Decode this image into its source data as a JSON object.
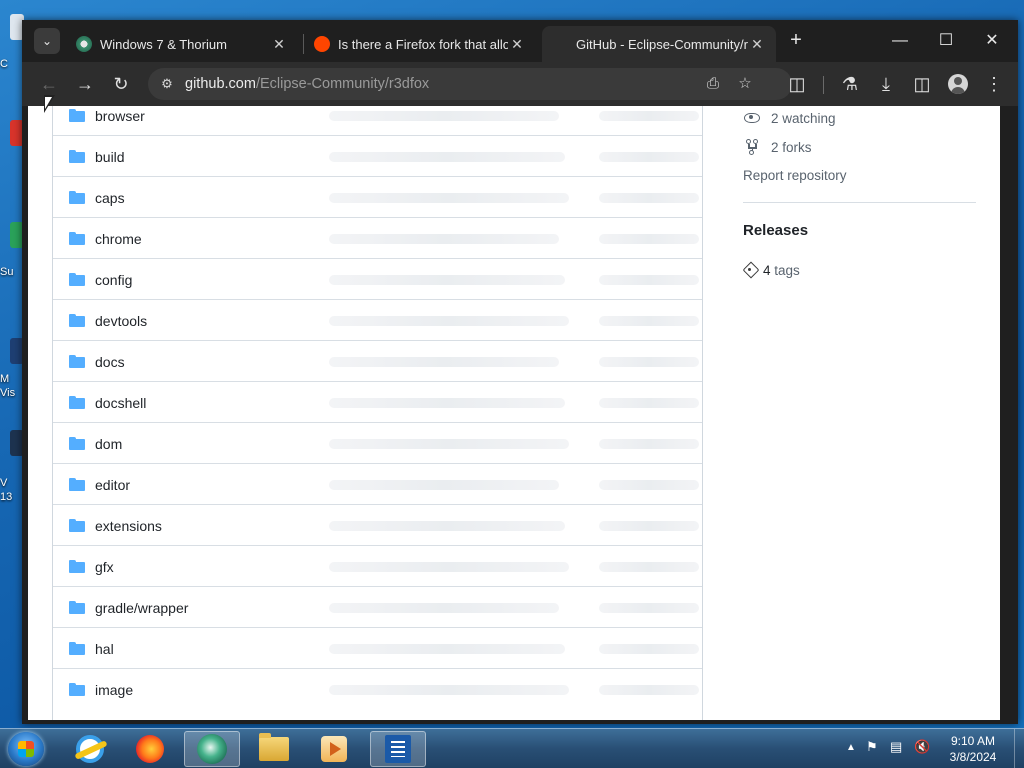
{
  "desktop": {
    "icon_labels": [
      "C",
      "Su",
      "M\nVis",
      "V\n13"
    ]
  },
  "browser": {
    "tabs": [
      {
        "title": "Windows 7 & Thorium",
        "favicon": "thorium-icon",
        "active": false
      },
      {
        "title": "Is there a Firefox fork that allo",
        "favicon": "reddit-icon",
        "active": false
      },
      {
        "title": "GitHub - Eclipse-Community/r",
        "favicon": "github-icon",
        "active": true
      }
    ],
    "new_tab": "+",
    "url_host": "github.com",
    "url_path": "/Eclipse-Community/r3dfox",
    "window_controls": {
      "minimize": "—",
      "maximize": "☐",
      "close": "✕"
    }
  },
  "file_list": [
    "browser",
    "build",
    "caps",
    "chrome",
    "config",
    "devtools",
    "docs",
    "docshell",
    "dom",
    "editor",
    "extensions",
    "gfx",
    "gradle/wrapper",
    "hal",
    "image"
  ],
  "sidebar": {
    "watching": "2 watching",
    "forks": "2 forks",
    "report": "Report repository",
    "releases_heading": "Releases",
    "tags_count": "4",
    "tags_label": "tags"
  },
  "taskbar": {
    "apps": [
      "internet-explorer",
      "firefox",
      "thorium",
      "windows-explorer",
      "media-player",
      "wordpad"
    ],
    "time": "9:10 AM",
    "date": "3/8/2024"
  },
  "colors": {
    "folder": "#54aeff",
    "link_muted": "#59636e",
    "heading": "#1f2328",
    "tab_strip": "#1f1f1f",
    "toolbar": "#2d2d2d"
  }
}
